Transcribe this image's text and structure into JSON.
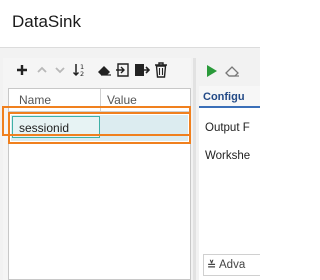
{
  "window": {
    "title": "DataSink"
  },
  "left_toolbar": {
    "icons": [
      "add-icon",
      "move-up-icon",
      "move-down-icon",
      "sort-icon",
      "eraser-icon",
      "import-icon",
      "export-icon",
      "delete-icon"
    ]
  },
  "grid": {
    "columns": [
      "Name",
      "Value"
    ],
    "rows": [
      {
        "name": "sessionid",
        "value": ""
      }
    ]
  },
  "right_panel": {
    "toolbar_icons": [
      "run-icon",
      "eraser-icon"
    ],
    "tab_label": "Configu",
    "fields": [
      "Output F",
      "Workshe"
    ],
    "advanced_label": "Adva"
  },
  "colors": {
    "highlight": "#f0801e",
    "selected_row": "#dcecf0",
    "tab_accent": "#3a6fb8",
    "run_green": "#2a9a3a"
  }
}
